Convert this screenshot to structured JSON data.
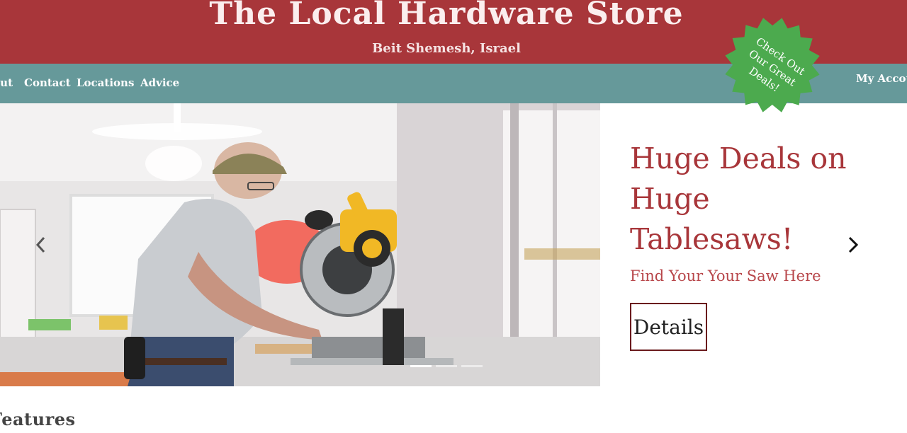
{
  "header": {
    "title": "The Local Hardware Store",
    "subtitle": "Beit Shemesh, Israel"
  },
  "nav": {
    "items": [
      {
        "label": "About",
        "visible_text": "out"
      },
      {
        "label": "Contact"
      },
      {
        "label": "Locations"
      },
      {
        "label": "Advice"
      }
    ],
    "account_label": "My Account"
  },
  "deal_badge": {
    "lines": [
      "Check Out",
      "Our Great",
      "Deals!"
    ],
    "color": "#4caa4e"
  },
  "carousel": {
    "heading": "Huge Deals on Huge Tablesaws!",
    "subheading": "Find Your Your Saw Here",
    "button_label": "Details",
    "prev_icon": "chevron-left-icon",
    "next_icon": "chevron-right-icon",
    "slide_count": 3,
    "active_slide": 1
  },
  "sections": {
    "features_heading": "Features"
  },
  "colors": {
    "header_bg": "#a8363a",
    "nav_bg": "#66999a",
    "accent_text": "#a8363a",
    "button_border": "#6a1a1d"
  }
}
